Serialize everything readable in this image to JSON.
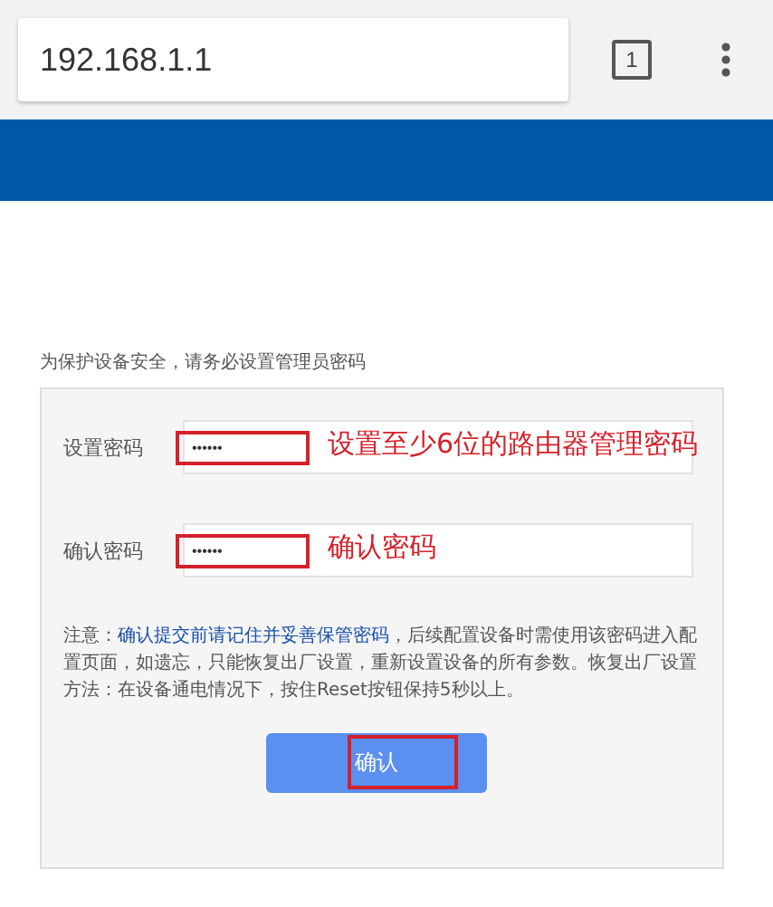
{
  "browser": {
    "url": "192.168.1.1",
    "tab_count": "1"
  },
  "intro": "为保护设备安全，请务必设置管理员密码",
  "fields": [
    {
      "label": "设置密码",
      "value": "••••••",
      "annotation": "设置至少6位的路由器管理密码"
    },
    {
      "label": "确认密码",
      "value": "••••••",
      "annotation": "确认密码"
    }
  ],
  "note": {
    "prefix": "注意：",
    "link": "确认提交前请记住并妥善保管密码",
    "rest": "，后续配置设备时需使用该密码进入配置页面，如遗忘，只能恢复出厂设置，重新设置设备的所有参数。恢复出厂设置方法：在设备通电情况下，按住Reset按钮保持5秒以上。"
  },
  "confirm_button": {
    "label": "确认"
  }
}
